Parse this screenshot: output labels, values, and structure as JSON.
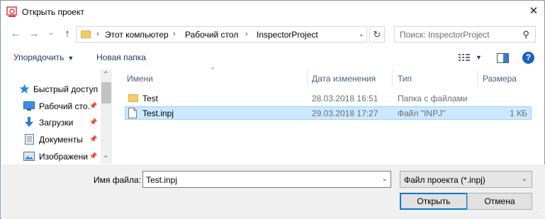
{
  "window": {
    "title": "Открыть проект",
    "close_glyph": "✕"
  },
  "nav": {
    "back_glyph": "←",
    "forward_glyph": "→",
    "recent_glyph": "⌄",
    "up_glyph": "↑",
    "breadcrumb": {
      "sep": "›",
      "items": [
        "Этот компьютер",
        "Рабочий стол",
        "InspectorProject"
      ]
    },
    "dropdown_glyph": "⌄",
    "refresh_glyph": "↻",
    "search": {
      "placeholder": "Поиск: InspectorProject",
      "icon_glyph": "⚲"
    }
  },
  "toolbar": {
    "organize": "Упорядочить",
    "arrow": "▼",
    "new_folder": "Новая папка",
    "help": "?"
  },
  "sidebar": {
    "items": [
      {
        "label": "Быстрый доступ",
        "icon": "star-icon",
        "pinned": false
      },
      {
        "label": "Рабочий сто.",
        "icon": "desktop-icon",
        "pinned": true
      },
      {
        "label": "Загрузки",
        "icon": "download-icon",
        "pinned": true
      },
      {
        "label": "Документы",
        "icon": "document-icon",
        "pinned": true
      },
      {
        "label": "Изображени",
        "icon": "image-icon",
        "pinned": true
      }
    ],
    "pin_glyph": "📌",
    "scroll_up": "⌃",
    "scroll_down": "⌄"
  },
  "files": {
    "sort_caret": "^",
    "columns": [
      "Имени",
      "Дата изменения",
      "Тип",
      "Размера"
    ],
    "rows": [
      {
        "name": "Test",
        "date": "28.03.2018 16:51",
        "type": "Папка с файлами",
        "size": "",
        "icon": "folder-icon",
        "selected": false
      },
      {
        "name": "Test.inpj",
        "date": "29.03.2018 17:27",
        "type": "Файл \"INPJ\"",
        "size": "1 КБ",
        "icon": "file-icon",
        "selected": true
      }
    ]
  },
  "footer": {
    "filename_label": "Имя файла:",
    "filename_value": "Test.inpj",
    "filter_value": "Файл проекта (*.inpj)",
    "open_label": "Открыть",
    "cancel_label": "Отмена",
    "grip": "⋰"
  },
  "colors": {
    "accent": "#0078d7",
    "selection": "#cce8ff",
    "folder": "#f2cd6d",
    "app_icon": "#d64040"
  }
}
